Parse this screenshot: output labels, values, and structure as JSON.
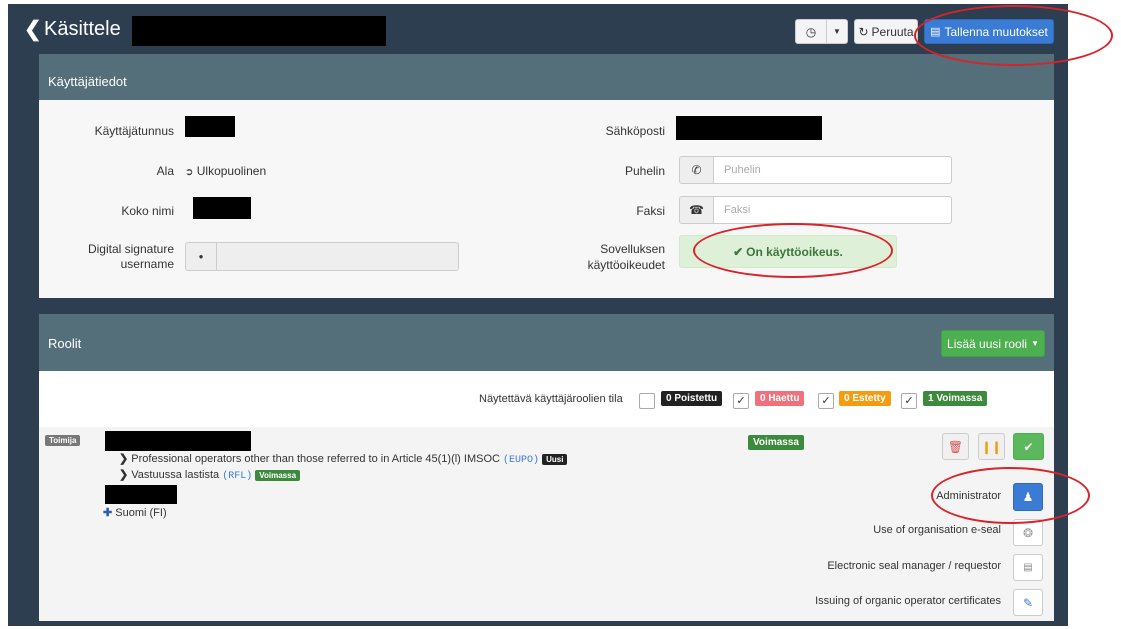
{
  "header": {
    "back_icon": "chevron-left-icon",
    "title": "Käsittele",
    "history_icon": "clock-icon",
    "cancel_label": "Peruuta",
    "save_label": "Tallenna muutokset"
  },
  "user_panel": {
    "title": "Käyttäjätiedot",
    "username_label": "Käyttäjätunnus",
    "email_label": "Sähköposti",
    "area_label": "Ala",
    "area_value": "Ulkopuolinen",
    "phone_label": "Puhelin",
    "phone_placeholder": "Puhelin",
    "fullname_label": "Koko nimi",
    "fax_label": "Faksi",
    "fax_placeholder": "Faksi",
    "digsig_label_1": "Digital signature",
    "digsig_label_2": "username",
    "access_label_1": "Sovelluksen",
    "access_label_2": "käyttöoikeudet",
    "access_value": "On käyttöoikeus."
  },
  "roles_panel": {
    "title": "Roolit",
    "add_role_label": "Lisää uusi rooli",
    "filter_label": "Näytettävä käyttäjäroolien tila",
    "filters": [
      {
        "label": "0 Poistettu",
        "checked": false,
        "color": "#222222"
      },
      {
        "label": "0 Haettu",
        "checked": true,
        "color": "#f0717c"
      },
      {
        "label": "0 Estetty",
        "checked": true,
        "color": "#f39c12"
      },
      {
        "label": "1 Voimassa",
        "checked": true,
        "color": "#3c8a3c"
      }
    ],
    "role": {
      "type_badge": "Toimija",
      "status": "Voimassa",
      "line1_text": "Professional operators other than those referred to in Article 45(1)(l) IMSOC",
      "line1_code": "(EUPO)",
      "line1_badge": "Uusi",
      "line2_text": "Vastuussa lastista",
      "line2_code": "(RFL)",
      "line2_badge": "Voimassa",
      "country": "Suomi (FI)"
    },
    "permissions": [
      {
        "label": "Administrator",
        "icon": "users-icon"
      },
      {
        "label": "Use of organisation e-seal",
        "icon": "seal-icon"
      },
      {
        "label": "Electronic seal manager / requestor",
        "icon": "id-card-icon"
      },
      {
        "label": "Issuing of organic operator certificates",
        "icon": "pencil-icon"
      }
    ]
  }
}
